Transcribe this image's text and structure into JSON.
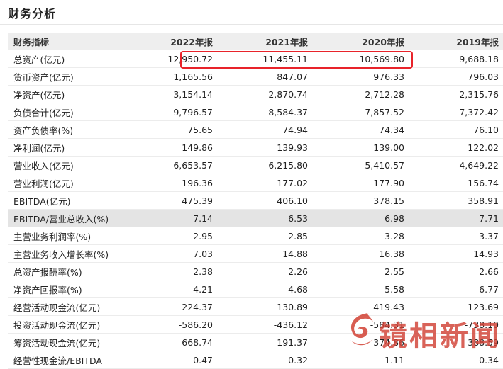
{
  "page": {
    "title": "财务分析"
  },
  "table": {
    "headers": [
      "财务指标",
      "2022年报",
      "2021年报",
      "2020年报",
      "2019年报"
    ],
    "rows": [
      [
        "总资产(亿元)",
        "12,950.72",
        "11,455.11",
        "10,569.80",
        "9,688.18"
      ],
      [
        "货币资产(亿元)",
        "1,165.56",
        "847.07",
        "976.33",
        "796.03"
      ],
      [
        "净资产(亿元)",
        "3,154.14",
        "2,870.74",
        "2,712.28",
        "2,315.76"
      ],
      [
        "负债合计(亿元)",
        "9,796.57",
        "8,584.37",
        "7,857.52",
        "7,372.42"
      ],
      [
        "资产负债率(%)",
        "75.65",
        "74.94",
        "74.34",
        "76.10"
      ],
      [
        "净利润(亿元)",
        "149.86",
        "139.93",
        "139.00",
        "122.02"
      ],
      [
        "营业收入(亿元)",
        "6,653.57",
        "6,215.80",
        "5,410.57",
        "4,649.22"
      ],
      [
        "营业利润(亿元)",
        "196.36",
        "177.02",
        "177.90",
        "156.74"
      ],
      [
        "EBITDA(亿元)",
        "475.39",
        "406.10",
        "378.15",
        "358.91"
      ],
      [
        "EBITDA/营业总收入(%)",
        "7.14",
        "6.53",
        "6.98",
        "7.71"
      ],
      [
        "主营业务利润率(%)",
        "2.95",
        "2.85",
        "3.28",
        "3.37"
      ],
      [
        "主营业务收入增长率(%)",
        "7.03",
        "14.88",
        "16.38",
        "14.93"
      ],
      [
        "总资产报酬率(%)",
        "2.38",
        "2.26",
        "2.55",
        "2.66"
      ],
      [
        "净资产回报率(%)",
        "4.21",
        "4.68",
        "5.58",
        "6.77"
      ],
      [
        "经营活动现金流(亿元)",
        "224.37",
        "130.89",
        "419.43",
        "123.69"
      ],
      [
        "投资活动现金流(亿元)",
        "-586.20",
        "-436.12",
        "-584.31",
        "-738.10"
      ],
      [
        "筹资活动现金流(亿元)",
        "668.74",
        "191.37",
        "374.86",
        "388.59"
      ],
      [
        "经营性现金流/EBITDA",
        "0.47",
        "0.32",
        "1.11",
        "0.34"
      ]
    ],
    "highlighted_row": 9
  },
  "watermark": {
    "text": "镜相新闻",
    "logo": "swirl-logo-icon",
    "color": "#d14134"
  },
  "colors": {
    "annotation_box": "#e8232a",
    "header_bg": "#eeeeee",
    "highlight_bg": "#e4e4e4"
  }
}
